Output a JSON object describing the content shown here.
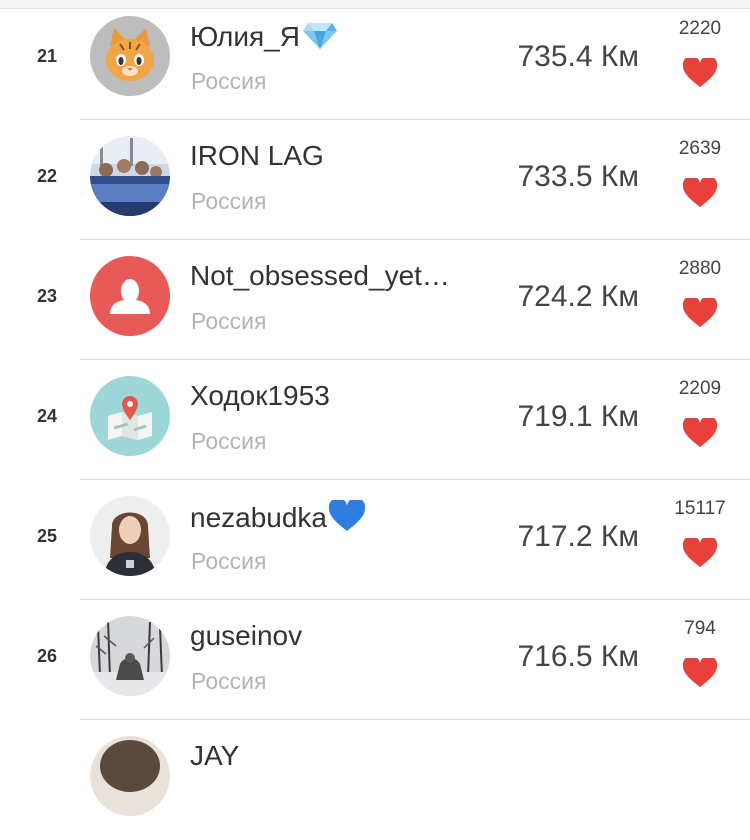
{
  "leaderboard": {
    "country_label": "Россия",
    "unit": "Км",
    "rows": [
      {
        "rank": "21",
        "name": "Юлия_Я",
        "distance": "735.4 Км",
        "likes": "2220"
      },
      {
        "rank": "22",
        "name": "IRON  LAG",
        "distance": "733.5 Км",
        "likes": "2639"
      },
      {
        "rank": "23",
        "name": "Not_obsessed_yet…",
        "distance": "724.2 Км",
        "likes": "2880"
      },
      {
        "rank": "24",
        "name": "Ходок1953",
        "distance": "719.1 Км",
        "likes": "2209"
      },
      {
        "rank": "25",
        "name": "nezabudka",
        "distance": "717.2 Км",
        "likes": "15117"
      },
      {
        "rank": "26",
        "name": "guseinov",
        "distance": "716.5 Км",
        "likes": "794"
      },
      {
        "rank": "",
        "name": "JAY",
        "distance": "",
        "likes": ""
      }
    ]
  },
  "colors": {
    "heart": "#e8403a",
    "default_avatar": "#e85a58",
    "country": "#b4b4b4"
  },
  "icons": {
    "like": "heart-icon",
    "default_avatar": "person-silhouette-icon",
    "map_avatar": "map-pin-icon",
    "diamond": "gem-icon",
    "blue_heart": "blue-heart-icon"
  }
}
